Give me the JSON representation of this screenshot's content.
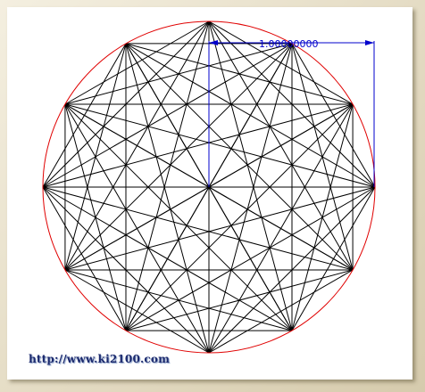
{
  "figure": {
    "dimension_label": "1.00000000",
    "watermark": "http://www.ki2100.com"
  },
  "colors": {
    "circle": "#e00000",
    "lines": "#000000",
    "dimension": "#0000cc",
    "background": "#ffffff"
  }
}
